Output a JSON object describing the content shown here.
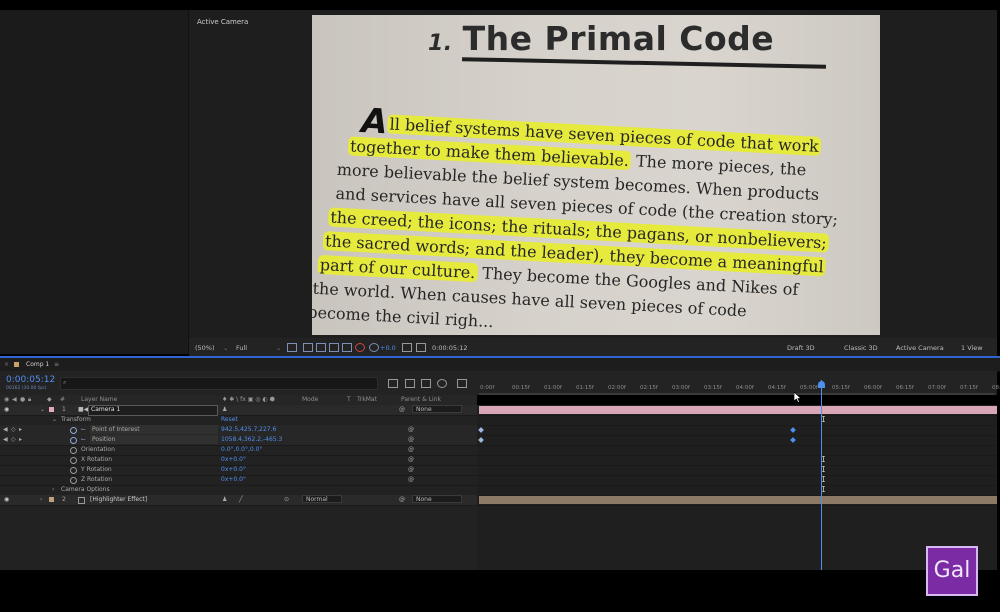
{
  "viewer": {
    "label": "Active Camera",
    "image": {
      "title_num": "1.",
      "title": "The Primal Code",
      "dropcap": "A",
      "lines": [
        {
          "hl": "ll belief systems have seven pieces of code that work",
          "rest": ""
        },
        {
          "hl": "together to make them believable.",
          "rest": " The more pieces, the"
        },
        {
          "hl": "",
          "rest": "more believable the belief system becomes. When products"
        },
        {
          "hl": "",
          "rest": "and services have all seven pieces of code (the creation story;"
        },
        {
          "hl": "the creed; the icons; the rituals; the pagans, or nonbelievers;",
          "rest": ""
        },
        {
          "hl": "the sacred words; and the leader), they become a meaningful",
          "rest": ""
        },
        {
          "hl": "part of our culture.",
          "rest": " They become the Googles and Nikes of"
        },
        {
          "hl": "",
          "rest": "the world. When causes have all seven pieces of code"
        },
        {
          "hl": "",
          "rest": "become the civil righ..."
        }
      ]
    }
  },
  "viewer_bar": {
    "zoom": "(50%)",
    "resolution": "Full",
    "exposure": "+0.0",
    "timecode": "0:00:05:12",
    "draft": "Draft 3D",
    "renderer": "Classic 3D",
    "camera": "Active Camera",
    "views": "1 View"
  },
  "timeline": {
    "comp_tab": "Comp 1",
    "timecode": "0:00:05:12",
    "frame_info": "00162 (30.00 fps)",
    "search_placeholder": "",
    "ruler_ticks": [
      "0:00f",
      "00:15f",
      "01:00f",
      "01:15f",
      "02:00f",
      "02:15f",
      "03:00f",
      "03:15f",
      "04:00f",
      "04:15f",
      "05:00f",
      "05:15f",
      "06:00f",
      "06:15f",
      "07:00f",
      "07:15f",
      "08:0"
    ],
    "columns": {
      "layer_name": "Layer Name",
      "mode": "Mode",
      "t": "T",
      "trkmat": "TrkMat",
      "parent": "Parent & Link",
      "num": "#"
    },
    "layers": [
      {
        "num": "1",
        "name": "Camera 1",
        "parent": "None",
        "color": "#e6a5c0"
      },
      {
        "num": "2",
        "name": "[Highlighter Effect]",
        "mode": "Normal",
        "parent": "None",
        "color": "#c0a07a"
      }
    ],
    "transform": {
      "label": "Transform",
      "reset": "Reset",
      "props": [
        {
          "name": "Point of Interest",
          "value": "942.5,425.7,227.6"
        },
        {
          "name": "Position",
          "value": "1058.4,362.2,-465.3"
        },
        {
          "name": "Orientation",
          "value": "0.0°,0.0°,0.0°"
        },
        {
          "name": "X Rotation",
          "value": "0x+0.0°"
        },
        {
          "name": "Y Rotation",
          "value": "0x+0.0°"
        },
        {
          "name": "Z Rotation",
          "value": "0x+0.0°"
        }
      ]
    },
    "camera_options": "Camera Options",
    "playhead_fraction": 0.66
  },
  "logo": {
    "text": "Gal"
  },
  "colors": {
    "accent": "#4f8ff0",
    "camera_bar": "#d9a6b8",
    "effect_bar": "#8c7a64",
    "logo_bg": "#7b2ba3"
  }
}
